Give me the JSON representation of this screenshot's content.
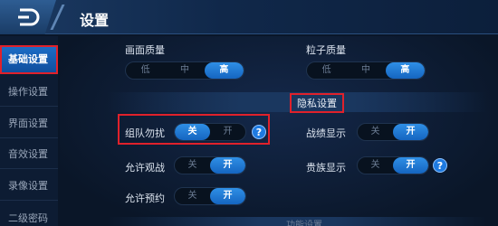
{
  "header": {
    "title": "设置"
  },
  "sidebar": {
    "items": [
      {
        "label": "基础设置",
        "active": true
      },
      {
        "label": "操作设置"
      },
      {
        "label": "界面设置"
      },
      {
        "label": "音效设置"
      },
      {
        "label": "录像设置"
      },
      {
        "label": "二级密码"
      }
    ]
  },
  "quality": {
    "screen": {
      "label": "画面质量",
      "options": [
        "低",
        "中",
        "高"
      ],
      "selected": "高"
    },
    "particle": {
      "label": "粒子质量",
      "options": [
        "低",
        "中",
        "高"
      ],
      "selected": "高"
    }
  },
  "privacy": {
    "title": "隐私设置",
    "settings": {
      "team_dnd": {
        "label": "组队勿扰",
        "off": "关",
        "on": "开",
        "selected": "关"
      },
      "allow_watch": {
        "label": "允许观战",
        "off": "关",
        "on": "开",
        "selected": "开"
      },
      "allow_reserve": {
        "label": "允许预约",
        "off": "关",
        "on": "开",
        "selected": "开"
      },
      "record_show": {
        "label": "战绩显示",
        "off": "关",
        "on": "开",
        "selected": "开"
      },
      "noble_show": {
        "label": "贵族显示",
        "off": "关",
        "on": "开",
        "selected": "开"
      }
    },
    "help_glyph": "?"
  },
  "next_section": {
    "title": "功能设置"
  },
  "colors": {
    "accent": "#1e7ae0",
    "highlight_border": "#e0212b",
    "background": "#0a1628"
  }
}
